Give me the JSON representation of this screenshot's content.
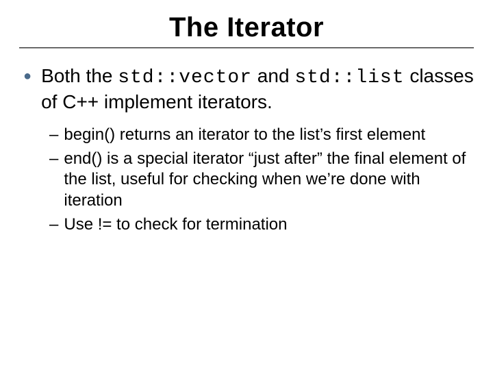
{
  "title": "The Iterator",
  "bullet": {
    "t1": "Both the ",
    "c1": "std::vector",
    "t2": " and ",
    "c2": "std::list",
    "t3": " classes of C++ implement iterators."
  },
  "sub": [
    "begin() returns an iterator to the list’s first element",
    "end() is a special iterator “just after” the final element of the list, useful for checking when we’re done with iteration",
    "Use != to check for termination"
  ]
}
